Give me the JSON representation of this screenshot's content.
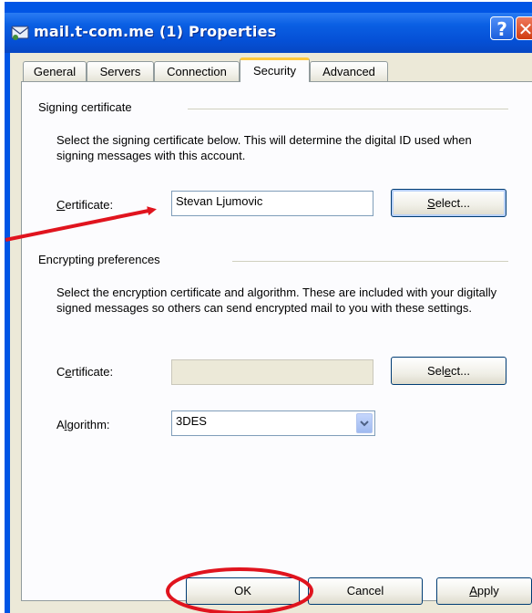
{
  "window": {
    "title": "mail.t-com.me (1) Properties",
    "help_label": "?",
    "close_label": "✕"
  },
  "tabs": [
    {
      "label": "General",
      "active": false
    },
    {
      "label": "Servers",
      "active": false
    },
    {
      "label": "Connection",
      "active": false
    },
    {
      "label": "Security",
      "active": true
    },
    {
      "label": "Advanced",
      "active": false
    }
  ],
  "signing": {
    "group_label": "Signing certificate",
    "description": "Select the signing certificate below. This will determine the digital ID used when signing messages with this account.",
    "certificate_label_pre": "",
    "certificate_label_mnemonic": "C",
    "certificate_label_post": "ertificate:",
    "certificate_value": "Stevan Ljumovic",
    "select_pre": "",
    "select_mnemonic": "S",
    "select_post": "elect..."
  },
  "encrypting": {
    "group_label": "Encrypting preferences",
    "description": "Select the encryption certificate and algorithm. These are included with your digitally signed messages so others can send encrypted mail to you with these settings.",
    "certificate_label_pre": "C",
    "certificate_label_mnemonic": "e",
    "certificate_label_post": "rtificate:",
    "certificate_value": "",
    "select_pre": "Sel",
    "select_mnemonic": "e",
    "select_post": "ct...",
    "algorithm_label_pre": "A",
    "algorithm_label_mnemonic": "l",
    "algorithm_label_post": "gorithm:",
    "algorithm_value": "3DES"
  },
  "footer": {
    "ok_label": "OK",
    "cancel_label": "Cancel",
    "apply_pre": "",
    "apply_mnemonic": "A",
    "apply_post": "pply"
  },
  "colors": {
    "annotation": "#e0141e",
    "title_bar": "#0a5fe3",
    "active_tab_highlight": "#ffc83c"
  }
}
